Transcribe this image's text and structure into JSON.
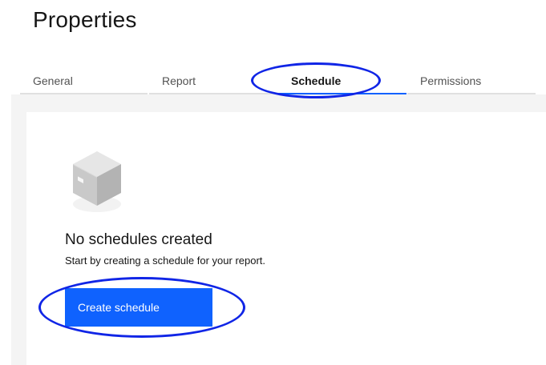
{
  "page": {
    "title": "Properties"
  },
  "tabs": [
    {
      "label": "General",
      "selected": false
    },
    {
      "label": "Report",
      "selected": false
    },
    {
      "label": "Schedule",
      "selected": true
    },
    {
      "label": "Permissions",
      "selected": false
    }
  ],
  "empty_state": {
    "icon": "box-icon",
    "title": "No schedules created",
    "description": "Start by creating a schedule for your report.",
    "button_label": "Create schedule"
  },
  "colors": {
    "accent": "#0f62fe",
    "annotation": "#1025e6",
    "panel_background": "#f4f4f4"
  }
}
